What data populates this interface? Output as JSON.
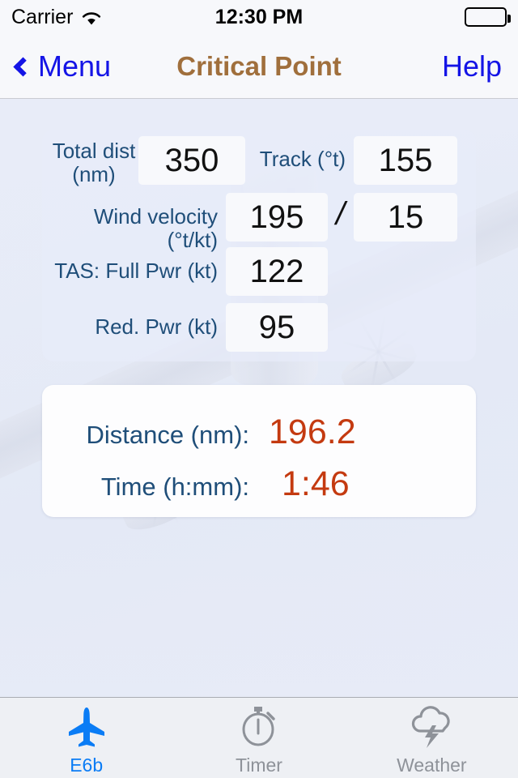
{
  "status_bar": {
    "carrier": "Carrier",
    "wifi_icon": "wifi-icon",
    "time": "12:30 PM",
    "battery_icon": "battery-full-icon"
  },
  "nav_bar": {
    "back_icon": "chevron-left-icon",
    "back_label": "Menu",
    "title": "Critical Point",
    "help_label": "Help",
    "title_color": "#a06f3c",
    "tint_color": "#1414e6"
  },
  "inputs": {
    "total_dist_label": "Total dist\n(nm)",
    "total_dist_label_line1": "Total dist",
    "total_dist_label_line2": "(nm)",
    "total_dist_value": "350",
    "track_label": "Track (°t)",
    "track_value": "155",
    "wind_velocity_label": "Wind velocity (°t/kt)",
    "wind_direction_value": "195",
    "wind_separator": "/",
    "wind_speed_value": "15",
    "tas_full_label": "TAS: Full Pwr (kt)",
    "tas_full_value": "122",
    "tas_red_label": "Red. Pwr (kt)",
    "tas_red_value": "95",
    "label_color": "#1f4e79"
  },
  "results": {
    "distance_label": "Distance (nm):",
    "distance_value": "196.2",
    "time_label": "Time (h:mm):",
    "time_value": "1:46",
    "value_color": "#c43a10"
  },
  "tab_bar": {
    "tabs": [
      {
        "label": "E6b",
        "icon": "airplane-icon",
        "active": true
      },
      {
        "label": "Timer",
        "icon": "stopwatch-icon",
        "active": false
      },
      {
        "label": "Weather",
        "icon": "thunderstorm-cloud-icon",
        "active": false
      }
    ],
    "active_color": "#0a7cf5",
    "inactive_color": "#8e9299"
  },
  "background": {
    "image_description": "faded photo of a twin-propeller aircraft seen from below"
  }
}
